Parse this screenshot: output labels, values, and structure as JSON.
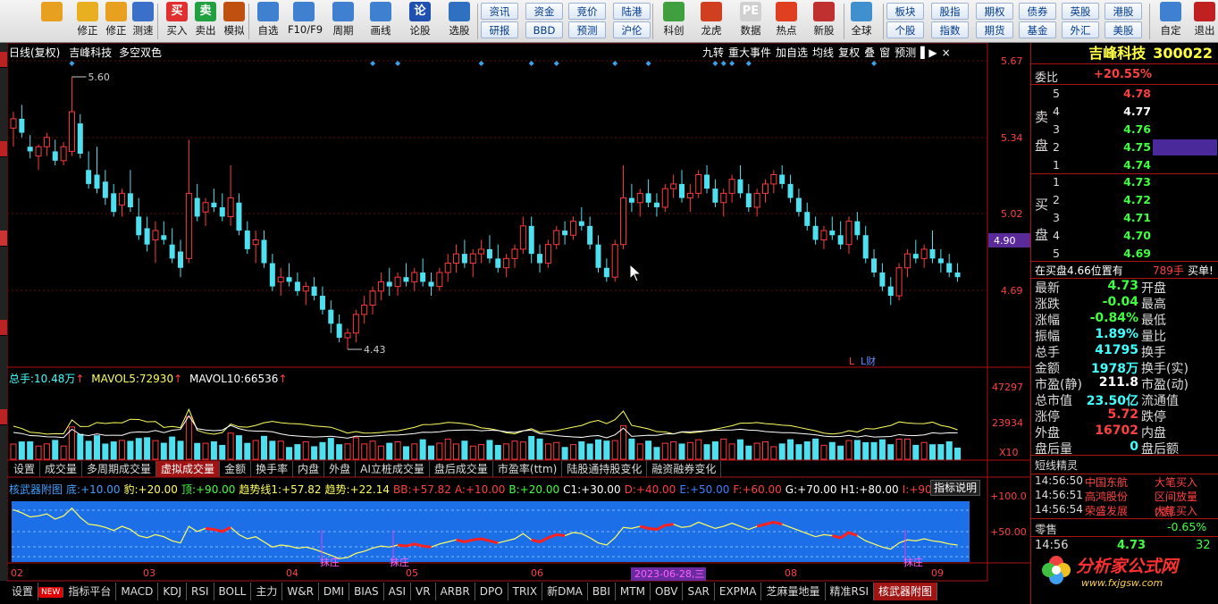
{
  "toolbar": {
    "buttons": [
      {
        "label": "",
        "icon": "back-arrow-icon"
      },
      {
        "label": "修正",
        "icon": "up-down-arrow-icon"
      },
      {
        "label": "修正",
        "icon": "gold-seal-icon"
      },
      {
        "label": "测速",
        "icon": "clock-icon"
      },
      {
        "label": "买入",
        "icon": "buy-icon",
        "glyph": "买"
      },
      {
        "label": "卖出",
        "icon": "sell-icon",
        "glyph": "卖"
      },
      {
        "label": "模拟",
        "icon": "hammer-icon"
      },
      {
        "label": "自选",
        "icon": "star-icon"
      },
      {
        "label": "F10/F9",
        "icon": "f10-icon"
      },
      {
        "label": "周期",
        "icon": "period-icon"
      },
      {
        "label": "画线",
        "icon": "pencil-icon"
      },
      {
        "label": "论股",
        "icon": "discuss-icon",
        "glyph": "论"
      },
      {
        "label": "选股",
        "icon": "select-icon"
      },
      {
        "label": "科创",
        "icon": "kechuang-icon"
      },
      {
        "label": "龙虎",
        "icon": "dragon-tiger-icon"
      },
      {
        "label": "数据",
        "icon": "pe-icon",
        "glyph": "PE"
      },
      {
        "label": "热点",
        "icon": "hot-icon"
      },
      {
        "label": "新股",
        "icon": "new-stock-icon"
      },
      {
        "label": "全球",
        "icon": "globe-icon"
      },
      {
        "label": "自定",
        "icon": "custom-icon"
      },
      {
        "label": "退出",
        "icon": "exit-icon"
      }
    ],
    "small": [
      [
        "资讯",
        "研报"
      ],
      [
        "资金",
        "BBD"
      ],
      [
        "竞价",
        "预测"
      ],
      [
        "陆港",
        "沪伦"
      ],
      [
        "板块",
        "个股"
      ],
      [
        "股指",
        "指数"
      ],
      [
        "期权",
        "期货"
      ],
      [
        "债券",
        "基金"
      ],
      [
        "英股",
        "外汇"
      ],
      [
        "港股",
        "美股"
      ]
    ]
  },
  "header": {
    "mode": "日线(复权)",
    "name": "吉峰科技",
    "signal": "多空双色"
  },
  "chart_tools": [
    "九转",
    "重大事件",
    "加自选",
    "均线",
    "复权",
    "叠",
    "窗",
    "预测"
  ],
  "price_axis": [
    "5.67",
    "5.34",
    "5.02",
    "4.69"
  ],
  "current_price_tag": "4.90",
  "high_label": "5.60",
  "low_label": "4.43",
  "fin_marks": [
    "L",
    "L财"
  ],
  "volume": {
    "label": "总手:",
    "total": "10.48万",
    "mavol5_label": "MAVOL5:",
    "mavol5": "72930",
    "mavol10_label": "MAVOL10:",
    "mavol10": "66536",
    "axis": [
      "47297",
      "23934"
    ],
    "unit": "X10"
  },
  "vol_tabs": [
    "设置",
    "成交量",
    "多周期成交量",
    "虚拟成交量",
    "金额",
    "换手率",
    "内盘",
    "外盘",
    "AI立桩成交量",
    "盘后成交量",
    "市盈率(ttm)",
    "陆股通持股变化",
    "融资融券变化"
  ],
  "vol_tab_active": "虚拟成交量",
  "indicator": {
    "name": "核武器附图",
    "values": [
      {
        "k": "底:",
        "v": "+10.00",
        "c": "#40a0ff"
      },
      {
        "k": "豹:",
        "v": "+20.00",
        "c": "#ffff60"
      },
      {
        "k": "顶:",
        "v": "+90.00",
        "c": "#40ff40"
      },
      {
        "k": "趋势线1:",
        "v": "+57.82",
        "c": "#ffff60"
      },
      {
        "k": "趋势:",
        "v": "+22.14",
        "c": "#ffff60"
      },
      {
        "k": "BB:",
        "v": "+57.82",
        "c": "#ff4040"
      },
      {
        "k": "A:",
        "v": "+10.00",
        "c": "#ff4040"
      },
      {
        "k": "B:",
        "v": "+20.00",
        "c": "#40ff40"
      },
      {
        "k": "C1:",
        "v": "+30.00",
        "c": "#ffffff"
      },
      {
        "k": "D:",
        "v": "+40.00",
        "c": "#ff4040"
      },
      {
        "k": "E:",
        "v": "+50.00",
        "c": "#4080ff"
      },
      {
        "k": "F:",
        "v": "+60.00",
        "c": "#ff4040"
      },
      {
        "k": "G:",
        "v": "+70.00",
        "c": "#ffffff"
      },
      {
        "k": "H1:",
        "v": "+80.00",
        "c": "#ffffff"
      },
      {
        "k": "I:",
        "v": "+90.00",
        "c": "#ff4040"
      },
      {
        "k": "J:",
        "v": "+",
        "c": "#4080ff"
      }
    ],
    "help": "指标说明",
    "axis": [
      "+100.0",
      "+50.00"
    ],
    "bottom_text": "底部",
    "sell_marks": [
      "抹庄",
      "抹庄",
      "抹庄"
    ]
  },
  "x_axis": [
    "02",
    "03",
    "04",
    "05",
    "06",
    "08",
    "09"
  ],
  "x_axis_highlight": "2023-06-28,三",
  "bottom_tabs": [
    "设置",
    "NEW",
    "指标平台",
    "MACD",
    "KDJ",
    "RSI",
    "BOLL",
    "主力",
    "W&R",
    "DMI",
    "BIAS",
    "ASI",
    "VR",
    "ARBR",
    "DPO",
    "TRIX",
    "新DMA",
    "BBI",
    "MTM",
    "OBV",
    "SAR",
    "EXPMA",
    "芝麻量地量",
    "精准RSI",
    "核武器附图"
  ],
  "bottom_tab_active": "核武器附图",
  "right": {
    "stock_name": "吉峰科技",
    "stock_code": "300022",
    "weibi_label": "委比",
    "weibi": "+20.55%",
    "sell_side": "卖",
    "sell_side2": "盘",
    "sell": [
      {
        "n": "5",
        "p": "4.78",
        "c": "#ff4040"
      },
      {
        "n": "4",
        "p": "4.77",
        "c": "#ffffff"
      },
      {
        "n": "3",
        "p": "4.76",
        "c": "#40ff40"
      },
      {
        "n": "2",
        "p": "4.75",
        "c": "#40ff40"
      },
      {
        "n": "1",
        "p": "4.74",
        "c": "#40ff40"
      }
    ],
    "buy_side": "买",
    "buy_side2": "盘",
    "buy": [
      {
        "n": "1",
        "p": "4.73",
        "c": "#40ff40"
      },
      {
        "n": "2",
        "p": "4.72",
        "c": "#40ff40"
      },
      {
        "n": "3",
        "p": "4.71",
        "c": "#40ff40"
      },
      {
        "n": "4",
        "p": "4.70",
        "c": "#40ff40"
      },
      {
        "n": "5",
        "p": "4.69",
        "c": "#40ff40"
      }
    ],
    "notice": "在买盘4.66位置有",
    "notice_qty": "789手",
    "notice_action": "买单!",
    "quotes": [
      {
        "l": "最新",
        "v": "4.73",
        "c": "#40ff40",
        "r": "开盘"
      },
      {
        "l": "涨跌",
        "v": "-0.04",
        "c": "#40ff40",
        "r": "最高"
      },
      {
        "l": "涨幅",
        "v": "-0.84%",
        "c": "#40ff40",
        "r": "最低"
      },
      {
        "l": "振幅",
        "v": "1.89%",
        "c": "#40ffff",
        "r": "量比"
      },
      {
        "l": "总手",
        "v": "41795",
        "c": "#40ffff",
        "r": "换手"
      },
      {
        "l": "金额",
        "v": "1978万",
        "c": "#40ffff",
        "r": "换手(实)"
      },
      {
        "l": "市盈(静)",
        "v": "211.8",
        "c": "#ffffff",
        "r": "市盈(动)"
      },
      {
        "l": "总市值",
        "v": "23.50亿",
        "c": "#40ffff",
        "r": "流通值"
      },
      {
        "l": "涨停",
        "v": "5.72",
        "c": "#ff4040",
        "r": "跌停"
      },
      {
        "l": "外盘",
        "v": "16702",
        "c": "#ff4040",
        "r": "内盘"
      },
      {
        "l": "盘后量",
        "v": "0",
        "c": "#40ffff",
        "r": "盘后额"
      }
    ],
    "short_title": "短线精灵",
    "ticks": [
      {
        "t": "14:56:50",
        "n": "中国东航",
        "e": "大笔买入"
      },
      {
        "t": "14:56:51",
        "n": "高鸿股份",
        "e": "区间放量(涨)"
      },
      {
        "t": "14:56:54",
        "n": "荣盛发展",
        "e": "大笔买入"
      }
    ],
    "sector": "零售",
    "sector_chg": "-0.65%",
    "last_time": "14:56",
    "last_price": "4.73",
    "last_vol": "32"
  },
  "logo": {
    "text": "分析家公式网",
    "url": "www.fxjgsw.com"
  },
  "colors": {
    "up": "#ff3b3b",
    "down": "#4fe0f0",
    "bg": "#000000",
    "frame": "#b01010"
  },
  "chart_data": {
    "type": "candlestick",
    "y_range": [
      4.43,
      5.6
    ],
    "candles": [
      [
        5.38,
        5.45,
        5.3,
        5.42
      ],
      [
        5.42,
        5.48,
        5.34,
        5.36
      ],
      [
        5.3,
        5.35,
        5.25,
        5.28
      ],
      [
        5.26,
        5.31,
        5.2,
        5.3
      ],
      [
        5.3,
        5.36,
        5.26,
        5.34
      ],
      [
        5.28,
        5.33,
        5.22,
        5.24
      ],
      [
        5.24,
        5.32,
        5.22,
        5.3
      ],
      [
        5.28,
        5.6,
        5.26,
        5.45
      ],
      [
        5.4,
        5.44,
        5.25,
        5.27
      ],
      [
        5.2,
        5.28,
        5.12,
        5.14
      ],
      [
        5.18,
        5.3,
        5.1,
        5.12
      ],
      [
        5.15,
        5.2,
        5.05,
        5.08
      ],
      [
        5.1,
        5.14,
        5.0,
        5.02
      ],
      [
        5.05,
        5.12,
        5.0,
        5.1
      ],
      [
        5.1,
        5.2,
        5.02,
        5.04
      ],
      [
        5.0,
        5.08,
        4.9,
        4.92
      ],
      [
        4.95,
        5.0,
        4.85,
        4.88
      ],
      [
        4.9,
        4.98,
        4.8,
        4.94
      ],
      [
        4.92,
        4.98,
        4.88,
        4.9
      ],
      [
        4.88,
        4.95,
        4.8,
        4.82
      ],
      [
        4.85,
        4.9,
        4.74,
        4.78
      ],
      [
        4.82,
        5.33,
        4.8,
        5.1
      ],
      [
        5.08,
        5.14,
        4.98,
        5.0
      ],
      [
        5.02,
        5.08,
        4.96,
        5.06
      ],
      [
        5.06,
        5.12,
        5.02,
        5.04
      ],
      [
        5.04,
        5.1,
        4.98,
        5.0
      ],
      [
        5.0,
        5.22,
        4.96,
        5.08
      ],
      [
        5.06,
        5.1,
        4.92,
        4.94
      ],
      [
        4.94,
        4.98,
        4.84,
        4.86
      ],
      [
        4.88,
        4.94,
        4.8,
        4.9
      ],
      [
        4.9,
        4.94,
        4.78,
        4.8
      ],
      [
        4.8,
        4.84,
        4.68,
        4.7
      ],
      [
        4.72,
        4.78,
        4.66,
        4.74
      ],
      [
        4.74,
        4.8,
        4.7,
        4.72
      ],
      [
        4.72,
        4.76,
        4.66,
        4.68
      ],
      [
        4.68,
        4.72,
        4.62,
        4.7
      ],
      [
        4.7,
        4.74,
        4.64,
        4.66
      ],
      [
        4.66,
        4.7,
        4.58,
        4.6
      ],
      [
        4.6,
        4.64,
        4.5,
        4.54
      ],
      [
        4.54,
        4.58,
        4.46,
        4.48
      ],
      [
        4.48,
        4.52,
        4.43,
        4.5
      ],
      [
        4.5,
        4.6,
        4.46,
        4.58
      ],
      [
        4.58,
        4.66,
        4.54,
        4.62
      ],
      [
        4.62,
        4.7,
        4.58,
        4.68
      ],
      [
        4.68,
        4.76,
        4.64,
        4.72
      ],
      [
        4.72,
        4.78,
        4.66,
        4.7
      ],
      [
        4.7,
        4.76,
        4.66,
        4.74
      ],
      [
        4.74,
        4.8,
        4.7,
        4.72
      ],
      [
        4.72,
        4.78,
        4.68,
        4.76
      ],
      [
        4.76,
        4.82,
        4.7,
        4.72
      ],
      [
        4.72,
        4.76,
        4.66,
        4.7
      ],
      [
        4.7,
        4.78,
        4.68,
        4.76
      ],
      [
        4.76,
        4.84,
        4.72,
        4.8
      ],
      [
        4.8,
        4.88,
        4.76,
        4.84
      ],
      [
        4.84,
        4.9,
        4.78,
        4.8
      ],
      [
        4.8,
        4.86,
        4.74,
        4.84
      ],
      [
        4.84,
        4.9,
        4.8,
        4.86
      ],
      [
        4.86,
        4.92,
        4.8,
        4.82
      ],
      [
        4.82,
        4.88,
        4.76,
        4.78
      ],
      [
        4.78,
        4.84,
        4.74,
        4.82
      ],
      [
        4.82,
        4.88,
        4.78,
        4.86
      ],
      [
        4.86,
        5.0,
        4.84,
        4.96
      ],
      [
        4.96,
        5.0,
        4.8,
        4.84
      ],
      [
        4.84,
        4.88,
        4.76,
        4.8
      ],
      [
        4.8,
        4.9,
        4.78,
        4.88
      ],
      [
        4.88,
        4.96,
        4.86,
        4.94
      ],
      [
        4.94,
        4.98,
        4.88,
        4.92
      ],
      [
        4.92,
        5.0,
        4.9,
        4.98
      ],
      [
        4.98,
        5.04,
        4.94,
        4.96
      ],
      [
        4.96,
        5.0,
        4.86,
        4.88
      ],
      [
        4.88,
        4.92,
        4.76,
        4.78
      ],
      [
        4.78,
        4.82,
        4.72,
        4.74
      ],
      [
        4.74,
        4.9,
        4.72,
        4.88
      ],
      [
        4.88,
        5.22,
        4.86,
        5.08
      ],
      [
        5.08,
        5.14,
        5.02,
        5.06
      ],
      [
        5.06,
        5.12,
        5.0,
        5.1
      ],
      [
        5.1,
        5.16,
        5.04,
        5.06
      ],
      [
        5.06,
        5.1,
        5.0,
        5.04
      ],
      [
        5.04,
        5.14,
        5.02,
        5.12
      ],
      [
        5.12,
        5.18,
        5.08,
        5.14
      ],
      [
        5.14,
        5.2,
        5.06,
        5.08
      ],
      [
        5.08,
        5.14,
        5.02,
        5.1
      ],
      [
        5.1,
        5.2,
        5.08,
        5.18
      ],
      [
        5.18,
        5.22,
        5.1,
        5.12
      ],
      [
        5.12,
        5.16,
        5.04,
        5.06
      ],
      [
        5.06,
        5.12,
        5.0,
        5.1
      ],
      [
        5.1,
        5.18,
        5.06,
        5.16
      ],
      [
        5.16,
        5.22,
        5.08,
        5.1
      ],
      [
        5.1,
        5.14,
        5.02,
        5.04
      ],
      [
        5.04,
        5.12,
        5.0,
        5.1
      ],
      [
        5.1,
        5.16,
        5.06,
        5.14
      ],
      [
        5.14,
        5.2,
        5.1,
        5.18
      ],
      [
        5.18,
        5.22,
        5.12,
        5.14
      ],
      [
        5.14,
        5.18,
        5.06,
        5.08
      ],
      [
        5.08,
        5.12,
        5.0,
        5.02
      ],
      [
        5.02,
        5.06,
        4.94,
        4.96
      ],
      [
        4.96,
        5.0,
        4.88,
        4.9
      ],
      [
        4.9,
        4.96,
        4.86,
        4.94
      ],
      [
        4.94,
        5.0,
        4.9,
        4.92
      ],
      [
        4.92,
        4.98,
        4.86,
        4.88
      ],
      [
        4.88,
        5.0,
        4.84,
        4.98
      ],
      [
        4.98,
        5.02,
        4.9,
        4.92
      ],
      [
        4.92,
        4.96,
        4.8,
        4.82
      ],
      [
        4.82,
        4.86,
        4.74,
        4.76
      ],
      [
        4.76,
        4.8,
        4.68,
        4.7
      ],
      [
        4.7,
        4.74,
        4.62,
        4.66
      ],
      [
        4.66,
        4.8,
        4.64,
        4.78
      ],
      [
        4.78,
        4.86,
        4.74,
        4.84
      ],
      [
        4.84,
        4.9,
        4.8,
        4.82
      ],
      [
        4.82,
        4.88,
        4.78,
        4.86
      ],
      [
        4.86,
        4.94,
        4.8,
        4.82
      ],
      [
        4.82,
        4.86,
        4.76,
        4.8
      ],
      [
        4.8,
        4.84,
        4.74,
        4.76
      ],
      [
        4.76,
        4.8,
        4.72,
        4.74
      ]
    ]
  }
}
